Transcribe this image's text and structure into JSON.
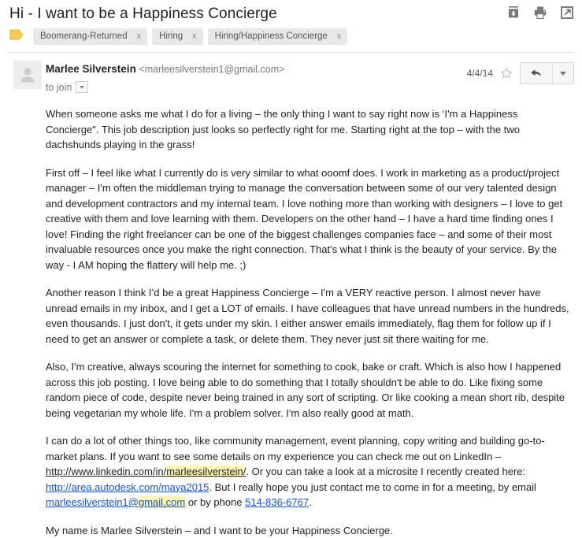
{
  "header": {
    "subject": "Hi - I want to be a Happiness Concierge",
    "actions": [
      {
        "name": "archive-icon",
        "title": "Move to Inbox"
      },
      {
        "name": "print-icon",
        "title": "Print all"
      },
      {
        "name": "open-in-new-window-icon",
        "title": "Open in new window"
      }
    ]
  },
  "labels": {
    "folder_icon": "label-folder-icon",
    "chips": [
      {
        "text": "Boomerang-Returned",
        "remove": "x"
      },
      {
        "text": "Hiring",
        "remove": "x"
      },
      {
        "text": "Hiring/Happiness Concierge",
        "remove": "x"
      }
    ]
  },
  "message": {
    "sender_name": "Marlee Silverstein",
    "sender_email": "<marleesilverstein1@gmail.com>",
    "recipient": "to join",
    "date": "4/4/14",
    "star_title": "Not starred",
    "reply_title": "Reply",
    "more_title": "More"
  },
  "body": {
    "p1": "When someone asks me what I do for a living – the only thing I want to say right now is ‘I'm a Happiness Concierge\".  This job description just looks so perfectly right for me. Starting right at the top – with the two dachshunds playing in the grass!",
    "p2": "First off – I feel like what I currently do is very similar to what ooomf does. I work in marketing as a product/project manager – I'm often the middleman trying to manage the conversation between some of our very talented design and development contractors and my internal team. I love nothing more than working with designers – I love to get creative with them and love learning with them. Developers on the other hand – I have a hard time finding ones I love! Finding the right freelancer can be one of the biggest challenges companies face – and some of their most invaluable resources once you make the right connection. That's what I think is the beauty of your service. By the way - I AM hoping the flattery will help me. ;)",
    "p3": "Another reason I think I’d be a great Happiness Concierge – I'm a VERY reactive person. I almost never have unread emails in my inbox, and I get a LOT of emails. I have colleagues that have unread numbers in the hundreds, even thousands. I just don't, it gets under my skin. I either answer emails immediately, flag them for follow up if I need to get an answer or complete a task, or delete them. They never just sit there waiting for me.",
    "p4": "Also, I'm creative, always scouring the internet for something to cook, bake or craft. Which is also how I happened across this job posting. I love being able to do something that I totally shouldn't be able to do. Like fixing some random piece of code, despite never being trained in any sort of scripting. Or like cooking a mean short rib, despite being vegetarian my whole life.  I'm a problem solver. I'm also really good at math.",
    "p5_a": "I can do a lot of other things too, like community management, event planning, copy writing and building go-to-market plans. If you want to see some details on my experience you can check me out on LinkedIn – ",
    "p5_link1_prefix": "http://www.",
    "p5_link1_mid": "linkedin.com/in/",
    "p5_link1_hl": "marleesilverstein",
    "p5_link1_suffix": "/",
    "p5_b": ". Or you can take a look at a microsite I recently created here: ",
    "p5_link2": "http://area.autodesk.com/maya2015",
    "p5_c": ". But I really hope you just contact me to come in for a meeting, by email ",
    "p5_email_a": "marleesilverstein1@",
    "p5_email_hl": "gmail.com",
    "p5_d": " or  by phone ",
    "p5_phone": "514-836-6767",
    "p5_e": ".",
    "p6": "My name is Marlee Silverstein – and I want to be your Happiness Concierge."
  },
  "colors": {
    "link_blue": "#1155cc",
    "highlight_yellow": "#fff7b2",
    "chip_bg": "#e8e8e8",
    "label_yellow": "#f4c430"
  }
}
